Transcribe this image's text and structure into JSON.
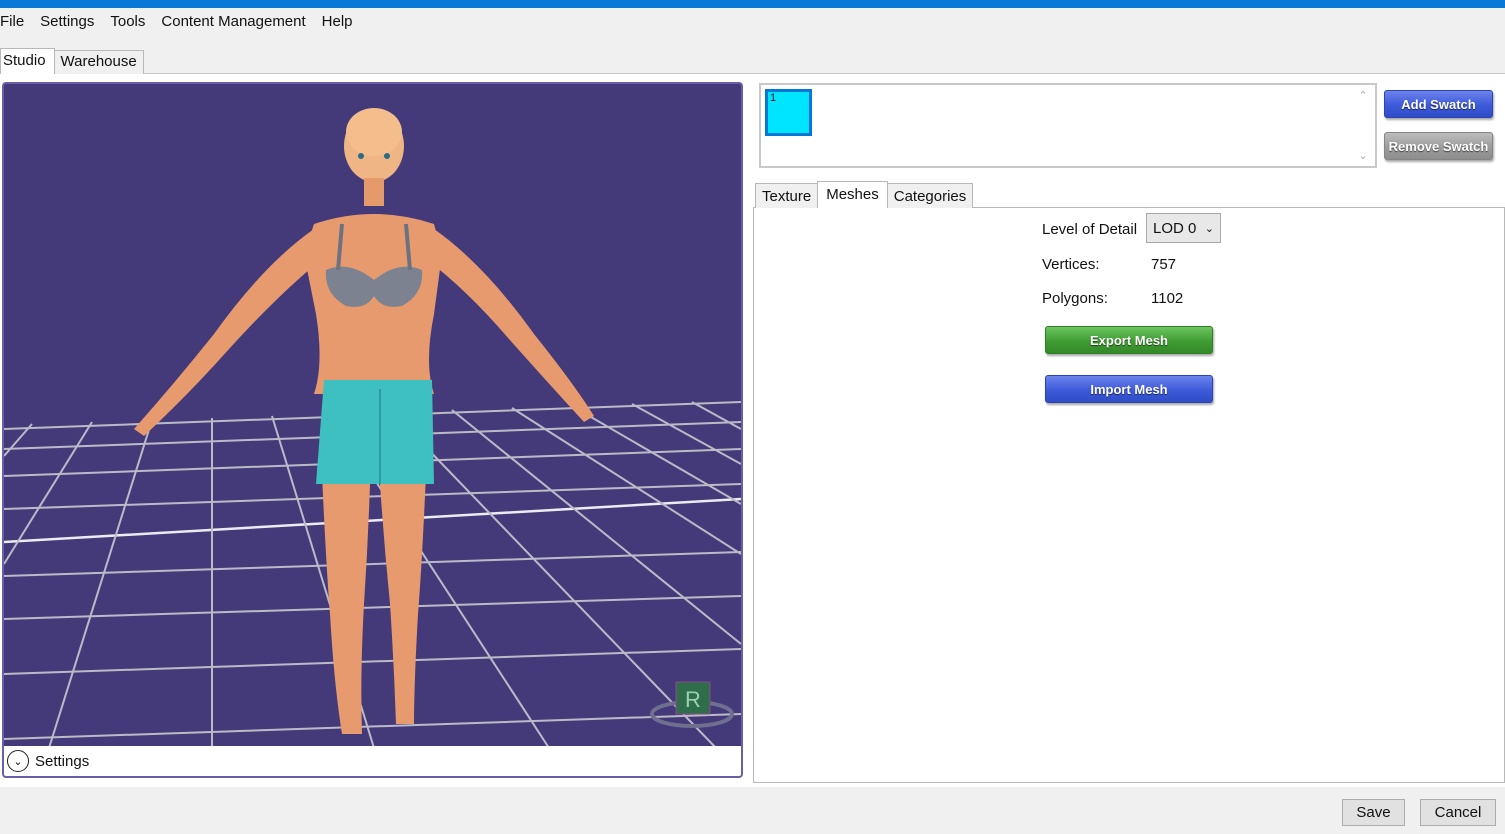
{
  "menu": [
    "File",
    "Settings",
    "Tools",
    "Content Management",
    "Help"
  ],
  "main_tabs": {
    "studio": "Studio",
    "warehouse": "Warehouse"
  },
  "viewport": {
    "settings_label": "Settings",
    "gizmo_letter": "R"
  },
  "swatches": {
    "items": [
      {
        "label": "1",
        "color": "#00e5ff"
      }
    ],
    "add_label": "Add Swatch",
    "remove_label": "Remove Swatch"
  },
  "sub_tabs": {
    "texture": "Texture",
    "meshes": "Meshes",
    "categories": "Categories"
  },
  "meshes": {
    "lod_label": "Level of Detail",
    "lod_value": "LOD 0",
    "vertices_label": "Vertices:",
    "vertices_value": "757",
    "polygons_label": "Polygons:",
    "polygons_value": "1102",
    "export_label": "Export Mesh",
    "import_label": "Import Mesh"
  },
  "footer": {
    "save": "Save",
    "cancel": "Cancel"
  },
  "colors": {
    "accent": "#0a78d7",
    "viewport_bg": "#443a7a",
    "swatch": "#00e5ff"
  }
}
